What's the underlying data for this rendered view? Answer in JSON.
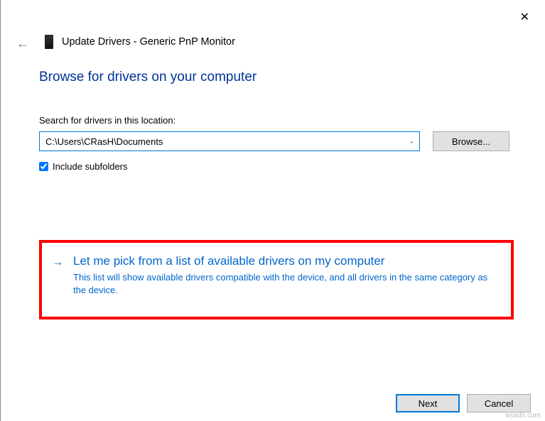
{
  "header": {
    "title": "Update Drivers - Generic PnP Monitor"
  },
  "main": {
    "heading": "Browse for drivers on your computer",
    "search_label": "Search for drivers in this location:",
    "path_value": "C:\\Users\\CRasH\\Documents",
    "browse_label": "Browse...",
    "subfolders_label": "Include subfolders",
    "subfolders_checked": true
  },
  "option": {
    "title": "Let me pick from a list of available drivers on my computer",
    "description": "This list will show available drivers compatible with the device, and all drivers in the same category as the device."
  },
  "footer": {
    "next_label": "Next",
    "cancel_label": "Cancel"
  },
  "watermark": "wsxdn.com"
}
